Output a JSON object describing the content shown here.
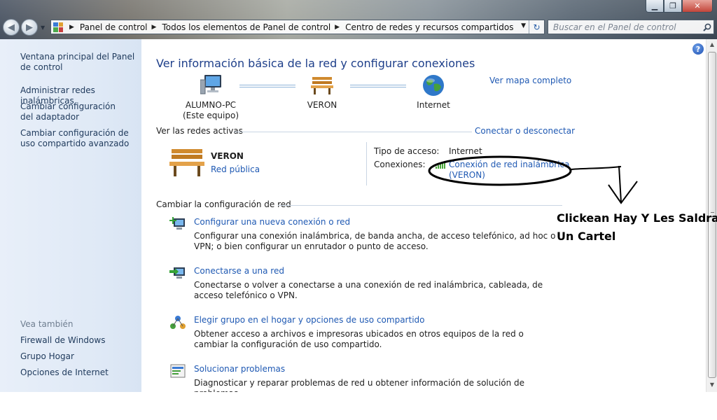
{
  "window": {
    "minimize_glyph": "▁",
    "maximize_glyph": "❐",
    "close_glyph": "✕"
  },
  "toolbar": {
    "back_glyph": "◀",
    "forward_glyph": "▶",
    "dropdown_glyph": "▼",
    "breadcrumbs": [
      "Panel de control",
      "Todos los elementos de Panel de control",
      "Centro de redes y recursos compartidos"
    ],
    "breadcrumb_sep": "▶",
    "refresh_glyph": "↻",
    "search_placeholder": "Buscar en el Panel de control"
  },
  "sidebar": {
    "links": [
      "Ventana principal del Panel de control",
      "Administrar redes inalámbricas",
      "Cambiar configuración del adaptador",
      "Cambiar configuración de uso compartido avanzado"
    ],
    "see_also_heading": "Vea también",
    "see_also": [
      "Firewall de Windows",
      "Grupo Hogar",
      "Opciones de Internet"
    ]
  },
  "main": {
    "title": "Ver información básica de la red y configurar conexiones",
    "map_full_link": "Ver mapa completo",
    "map_nodes": [
      {
        "line1": "ALUMNO-PC",
        "line2": "(Este equipo)",
        "icon": "computer-icon"
      },
      {
        "line1": "VERON",
        "line2": "",
        "icon": "bench-icon"
      },
      {
        "line1": "Internet",
        "line2": "",
        "icon": "globe-icon"
      }
    ],
    "active_networks_label": "Ver las redes activas",
    "connect_link": "Conectar o desconectar",
    "network_name": "VERON",
    "network_type_link": "Red pública",
    "access_type_label": "Tipo de acceso:",
    "access_type_value": "Internet",
    "connections_label": "Conexiones:",
    "connection_link_line1": "Conexión de red inalámbrica",
    "connection_link_line2": "(VERON)",
    "change_config_label": "Cambiar la configuración de red",
    "tasks": [
      {
        "title": "Configurar una nueva conexión o red",
        "desc": "Configurar una conexión inalámbrica, de banda ancha, de acceso telefónico, ad hoc o VPN; o bien configurar un enrutador o punto de acceso.",
        "icon": "new-connection-icon"
      },
      {
        "title": "Conectarse a una red",
        "desc": "Conectarse o volver a conectarse a una conexión de red inalámbrica, cableada, de acceso telefónico o VPN.",
        "icon": "connect-network-icon"
      },
      {
        "title": "Elegir grupo en el hogar y opciones de uso compartido",
        "desc": "Obtener acceso a archivos e impresoras ubicados en otros equipos de la red o cambiar la configuración de uso compartido.",
        "icon": "homegroup-icon"
      },
      {
        "title": "Solucionar problemas",
        "desc": "Diagnosticar y reparar problemas de red u obtener información de solución de problemas.",
        "icon": "troubleshoot-icon"
      }
    ]
  },
  "help_glyph": "?",
  "annotation": {
    "line1": "Clickean Hay Y Les Saldra",
    "line2": "Un Cartel"
  },
  "scrollbar": {
    "up_glyph": "▲",
    "down_glyph": "▼"
  }
}
